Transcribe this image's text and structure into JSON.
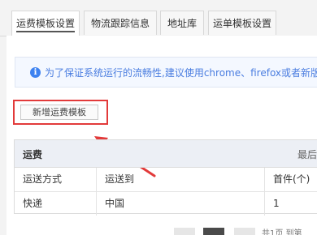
{
  "tabs": [
    {
      "label": "运费模板设置",
      "active": true
    },
    {
      "label": "物流跟踪信息",
      "active": false
    },
    {
      "label": "地址库",
      "active": false
    },
    {
      "label": "运单模板设置",
      "active": false
    }
  ],
  "info": {
    "icon": "info-icon",
    "text": "为了保证系统运行的流畅性,建议使用chrome、firefox或者新版"
  },
  "add_button": {
    "label": "新增运费模板"
  },
  "table": {
    "title": "运费",
    "right_text": "最后",
    "headers": [
      "运送方式",
      "运送到",
      "首件(个)"
    ],
    "rows": [
      [
        "快递",
        "中国",
        "1"
      ]
    ]
  },
  "pagination": {
    "text": "共1页 到第"
  },
  "colors": {
    "highlight": "#e23a3a",
    "info_text": "#4a7de0",
    "info_icon": "#3d82f0"
  }
}
